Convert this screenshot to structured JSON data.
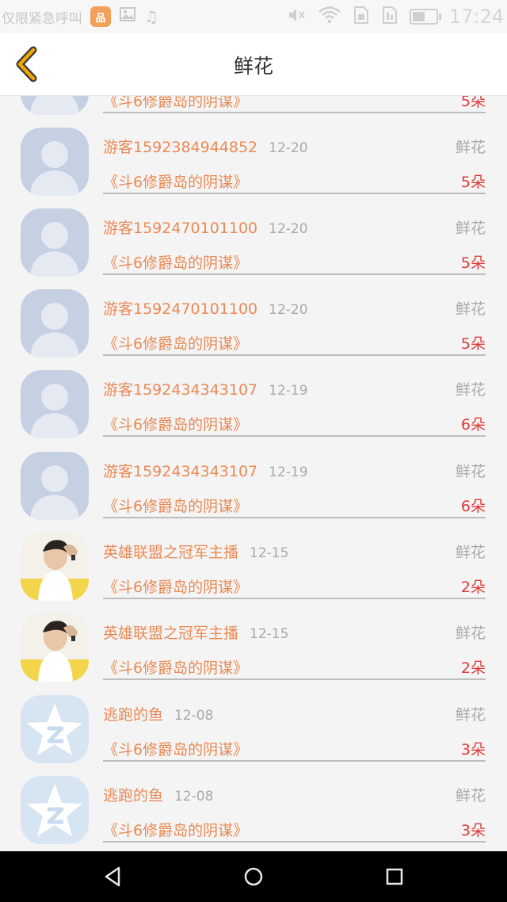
{
  "status_bar": {
    "carrier": "仅限紧急呼叫",
    "app_badge": "品",
    "time": "17:24",
    "battery_level": 0.55,
    "icons": [
      "app-badge-icon",
      "image-icon",
      "music-icon",
      "mute-icon",
      "wifi-icon",
      "sim-icon",
      "sim2-icon",
      "battery-icon"
    ]
  },
  "header": {
    "title": "鲜花",
    "back_icon": "chevron-left-icon",
    "accent": "#f3a800"
  },
  "list": {
    "partial_row": {
      "book": "《斗6修爵岛的阴谋》",
      "count": "5朵"
    },
    "rows": [
      {
        "name": "游客1592384944852",
        "date": "12-20",
        "tag": "鲜花",
        "book": "《斗6修爵岛的阴谋》",
        "count": "5朵",
        "avatar": "guest-avatar"
      },
      {
        "name": "游客1592470101100",
        "date": "12-20",
        "tag": "鲜花",
        "book": "《斗6修爵岛的阴谋》",
        "count": "5朵",
        "avatar": "guest-avatar"
      },
      {
        "name": "游客1592470101100",
        "date": "12-20",
        "tag": "鲜花",
        "book": "《斗6修爵岛的阴谋》",
        "count": "5朵",
        "avatar": "guest-avatar"
      },
      {
        "name": "游客1592434343107",
        "date": "12-19",
        "tag": "鲜花",
        "book": "《斗6修爵岛的阴谋》",
        "count": "6朵",
        "avatar": "guest-avatar"
      },
      {
        "name": "游客1592434343107",
        "date": "12-19",
        "tag": "鲜花",
        "book": "《斗6修爵岛的阴谋》",
        "count": "6朵",
        "avatar": "guest-avatar"
      },
      {
        "name": "英雄联盟之冠军主播",
        "date": "12-15",
        "tag": "鲜花",
        "book": "《斗6修爵岛的阴谋》",
        "count": "2朵",
        "avatar": "photo-avatar"
      },
      {
        "name": "英雄联盟之冠军主播",
        "date": "12-15",
        "tag": "鲜花",
        "book": "《斗6修爵岛的阴谋》",
        "count": "2朵",
        "avatar": "photo-avatar"
      },
      {
        "name": "逃跑的鱼",
        "date": "12-08",
        "tag": "鲜花",
        "book": "《斗6修爵岛的阴谋》",
        "count": "3朵",
        "avatar": "star-avatar"
      },
      {
        "name": "逃跑的鱼",
        "date": "12-08",
        "tag": "鲜花",
        "book": "《斗6修爵岛的阴谋》",
        "count": "3朵",
        "avatar": "star-avatar"
      }
    ]
  },
  "nav_bar": {
    "icons": [
      "back-triangle-icon",
      "home-circle-icon",
      "recents-square-icon"
    ]
  }
}
